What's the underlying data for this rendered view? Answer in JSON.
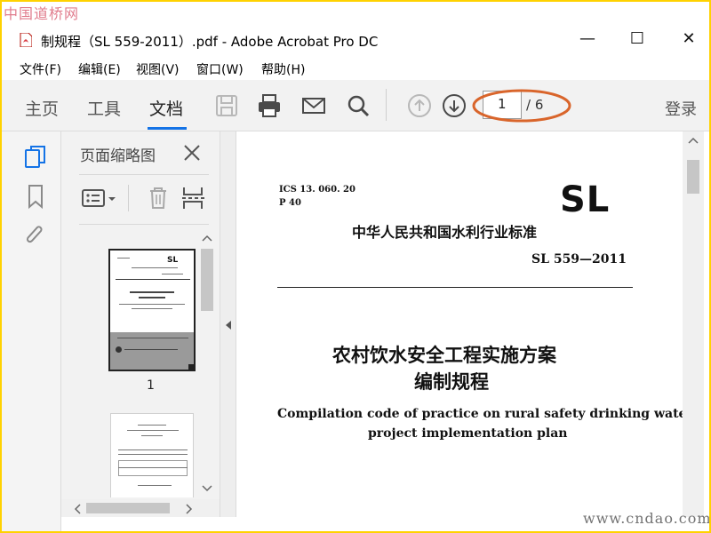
{
  "watermark": {
    "top_left": "中国道桥网",
    "bottom_right": "www.cndao.com"
  },
  "window": {
    "title": "制规程（SL 559-2011）.pdf - Adobe Acrobat Pro DC",
    "minimize": "—",
    "maximize": "☐",
    "close": "✕"
  },
  "menu": [
    "文件(F)",
    "编辑(E)",
    "视图(V)",
    "窗口(W)",
    "帮助(H)"
  ],
  "toolbar": {
    "tabs": [
      "主页",
      "工具",
      "文档"
    ],
    "active_tab": "文档",
    "current_page": "1",
    "page_total": "/ 6",
    "login": "登录",
    "accent": "#1473e6",
    "annotation_color": "#d9652b"
  },
  "left_rail_icons": [
    "pages-icon",
    "bookmark-icon",
    "attachment-icon"
  ],
  "thumbnails": {
    "title": "页面缩略图",
    "pages": [
      {
        "number": "1",
        "selected": true
      },
      {
        "number": "",
        "selected": false
      }
    ]
  },
  "document": {
    "ics": "ICS 13. 060. 20",
    "p": "P 40",
    "logo": "SL",
    "org": "中华人民共和国水利行业标准",
    "code": "SL 559—2011",
    "title_cn_1": "农村饮水安全工程实施方案",
    "title_cn_2": "编制规程",
    "title_en_1": "Compilation code of practice on rural safety drinking water",
    "title_en_2": "project implementation plan"
  }
}
